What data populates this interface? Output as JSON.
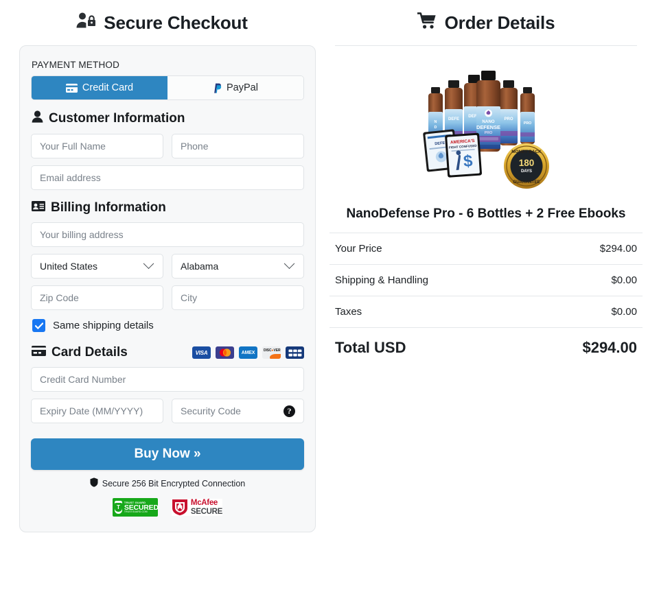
{
  "checkout": {
    "title": "Secure Checkout",
    "title_icon": "user-lock-icon",
    "payment_method_label": "PAYMENT METHOD",
    "tabs": [
      {
        "label": "Credit Card",
        "icon": "credit-card-icon",
        "active": true
      },
      {
        "label": "PayPal",
        "icon": "paypal-icon",
        "active": false
      }
    ],
    "customer_section": {
      "heading": "Customer Information",
      "icon": "user-icon",
      "fields": {
        "full_name_placeholder": "Your Full Name",
        "full_name_value": "",
        "phone_placeholder": "Phone",
        "phone_value": "",
        "email_placeholder": "Email address",
        "email_value": ""
      }
    },
    "billing_section": {
      "heading": "Billing Information",
      "icon": "id-card-icon",
      "fields": {
        "address_placeholder": "Your billing address",
        "address_value": "",
        "country_selected": "United States",
        "state_selected": "Alabama",
        "zip_placeholder": "Zip Code",
        "zip_value": "",
        "city_placeholder": "City",
        "city_value": ""
      },
      "same_shipping_label": "Same shipping details",
      "same_shipping_checked": true
    },
    "card_section": {
      "heading": "Card Details",
      "icon": "credit-card-icon",
      "accepted_cards": [
        "VISA",
        "Mastercard",
        "AMEX",
        "DISCOVER",
        "JCB"
      ],
      "fields": {
        "number_placeholder": "Credit Card Number",
        "number_value": "",
        "expiry_placeholder": "Expiry Date (MM/YYYY)",
        "expiry_value": "",
        "cvv_placeholder": "Security Code",
        "cvv_value": "",
        "cvv_help_icon": "question-circle-icon"
      }
    },
    "buy_button_label": "Buy Now »",
    "secure_note": "Secure 256 Bit Encrypted Connection",
    "secure_note_icon": "shield-icon",
    "trust_badges": [
      {
        "name": "trust-guard-secured",
        "line1": "TRUST GUARD",
        "line2": "SECURED",
        "line3": "TRUSTGUARD.COM"
      },
      {
        "name": "mcafee-secure",
        "line1": "McAfee",
        "line2": "SECURE"
      }
    ]
  },
  "order": {
    "title": "Order Details",
    "title_icon": "shopping-cart-icon",
    "product_name": "NanoDefense Pro - 6 Bottles + 2 Free Ebooks",
    "product_image": {
      "alt": "six-bottles-with-two-ebooks-and-guarantee-badge",
      "badge_top": "MONEY BACK",
      "badge_days": "180",
      "badge_days_label": "DAYS",
      "badge_bottom": "GUARANTEE",
      "bottle_label_line1": "NANO",
      "bottle_label_line2": "DEFENSE",
      "bottle_label_line3": "PRO",
      "ebook_title": "AMERICA'S"
    },
    "rows": [
      {
        "label": "Your Price",
        "value": "$294.00"
      },
      {
        "label": "Shipping & Handling",
        "value": "$0.00"
      },
      {
        "label": "Taxes",
        "value": "$0.00"
      }
    ],
    "total": {
      "label": "Total USD",
      "value": "$294.00"
    }
  },
  "colors": {
    "accent_blue": "#2e86c1",
    "checkbox_blue": "#1877f2",
    "panel_bg": "#f7f8f9",
    "border": "#dfe3e6",
    "text": "#212529",
    "placeholder": "#79818a",
    "trust_green": "#17a81a",
    "mcafee_red": "#c8102e"
  }
}
